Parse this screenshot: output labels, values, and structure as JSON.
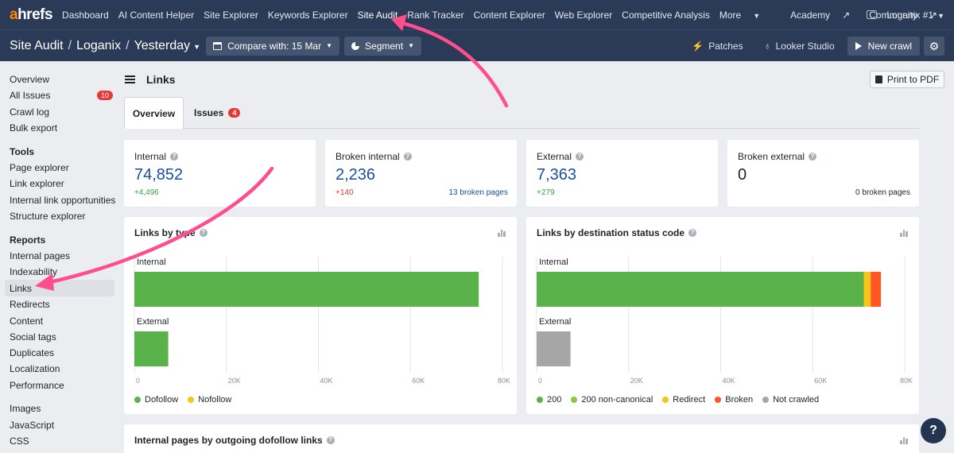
{
  "brand": {
    "logo_a": "a",
    "logo_rest": "hrefs"
  },
  "topnav": {
    "items": [
      "Dashboard",
      "AI Content Helper",
      "Site Explorer",
      "Keywords Explorer",
      "Site Audit",
      "Rank Tracker",
      "Content Explorer",
      "Web Explorer",
      "Competitive Analysis"
    ],
    "more": "More",
    "academy": "Academy",
    "community": "Community",
    "project": "Loganix #1"
  },
  "subhead": {
    "crumb1": "Site Audit",
    "crumb2": "Loganix",
    "crumb3": "Yesterday",
    "compare": "Compare with: 15 Mar",
    "segment": "Segment",
    "patches": "Patches",
    "looker": "Looker Studio",
    "new_crawl": "New crawl"
  },
  "sidebar": {
    "top": [
      "Overview",
      "All Issues",
      "Crawl log",
      "Bulk export"
    ],
    "issues_count": "10",
    "tools_heading": "Tools",
    "tools": [
      "Page explorer",
      "Link explorer",
      "Internal link opportunities",
      "Structure explorer"
    ],
    "reports_heading": "Reports",
    "reports": [
      "Internal pages",
      "Indexability",
      "Links",
      "Redirects",
      "Content",
      "Social tags",
      "Duplicates",
      "Localization",
      "Performance"
    ],
    "resources": [
      "Images",
      "JavaScript",
      "CSS"
    ]
  },
  "main": {
    "title": "Links",
    "print": "Print to PDF",
    "tab_overview": "Overview",
    "tab_issues": "Issues",
    "issues_badge": "4"
  },
  "stats": [
    {
      "label": "Internal",
      "value": "74,852",
      "delta": "+4,496",
      "right": ""
    },
    {
      "label": "Broken internal",
      "value": "2,236",
      "delta": "+140",
      "right": "13 broken pages"
    },
    {
      "label": "External",
      "value": "7,363",
      "delta": "+279",
      "right": ""
    },
    {
      "label": "Broken external",
      "value": "0",
      "delta": "",
      "right": "0 broken pages"
    }
  ],
  "bottom_title": "Internal pages by outgoing dofollow links",
  "help": "?",
  "colors": {
    "green": "#5ab34a",
    "lightgreen": "#8cc63f",
    "yellow": "#f5c518",
    "red": "#ff5722",
    "gray": "#a6a6a6",
    "nav": "#2b3a57",
    "arrow": "#ff4d8d"
  },
  "chart_data": [
    {
      "type": "bar",
      "title": "Links by type",
      "orientation": "horizontal",
      "categories": [
        "Internal",
        "External"
      ],
      "series": [
        {
          "name": "Dofollow",
          "values": [
            74852,
            7363
          ]
        },
        {
          "name": "Nofollow",
          "values": [
            0,
            0
          ]
        }
      ],
      "xlim": [
        0,
        80000
      ],
      "xticks": [
        "0",
        "20K",
        "40K",
        "60K",
        "80K"
      ],
      "grid": true,
      "legend": "bottom"
    },
    {
      "type": "bar",
      "title": "Links by destination status code",
      "orientation": "horizontal",
      "categories": [
        "Internal",
        "External"
      ],
      "series": [
        {
          "name": "200",
          "values": [
            71100,
            0
          ]
        },
        {
          "name": "200 non-canonical",
          "values": [
            0,
            0
          ]
        },
        {
          "name": "Redirect",
          "values": [
            1500,
            0
          ]
        },
        {
          "name": "Broken",
          "values": [
            2236,
            0
          ]
        },
        {
          "name": "Not crawled",
          "values": [
            0,
            7363
          ]
        }
      ],
      "xlim": [
        0,
        80000
      ],
      "xticks": [
        "0",
        "20K",
        "40K",
        "60K",
        "80K"
      ],
      "grid": true,
      "legend": "bottom"
    }
  ]
}
